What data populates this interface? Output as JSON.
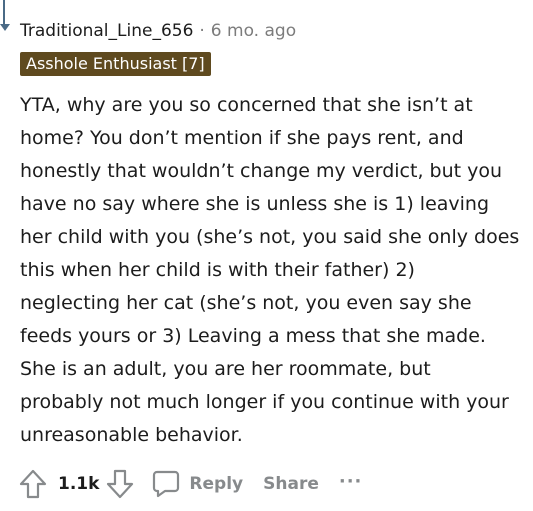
{
  "comment": {
    "author": "Traditional_Line_656",
    "separator": "·",
    "timestamp": "6 mo. ago",
    "flair": "Asshole Enthusiast [7]",
    "body": "YTA, why are you so concerned that she isn’t at home? You don’t mention if she pays rent, and honestly that wouldn’t change my verdict, but you have no say where she is unless she is 1) leaving her child with you (she’s not, you said she only does this when her child is with their father) 2) neglecting her cat (she’s not, you even say she feeds yours or 3) Leaving a mess that she made. She is an adult, you are her roommate, but probably not much longer if you continue with your unreasonable behavior.",
    "colors": {
      "flair_bg": "#5f4a1f",
      "muted": "#878a8c",
      "thread_line": "#4a6a86"
    }
  },
  "actions": {
    "upvote_icon": "upvote-arrow-icon",
    "score": "1.1k",
    "downvote_icon": "downvote-arrow-icon",
    "reply_icon": "speech-bubble-icon",
    "reply_label": "Reply",
    "share_label": "Share",
    "more_label": "···"
  }
}
